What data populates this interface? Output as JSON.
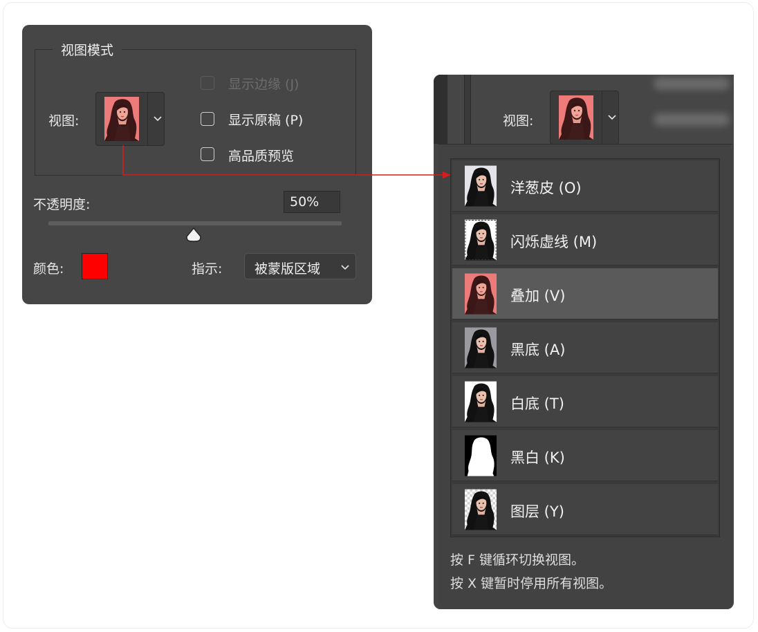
{
  "colors": {
    "panel_bg": "#464646",
    "accent_red": "#ff0000",
    "arrow_red": "#d91c1c",
    "menu_selected": "#5a5a5a"
  },
  "view_mode_panel": {
    "group_title": "视图模式",
    "view_label": "视图:",
    "checkboxes": [
      {
        "label": "显示边缘 (J)",
        "checked": false,
        "disabled": true
      },
      {
        "label": "显示原稿 (P)",
        "checked": false,
        "disabled": false
      },
      {
        "label": "高品质预览",
        "checked": false,
        "disabled": false
      }
    ],
    "opacity_label": "不透明度:",
    "opacity_value": "50%",
    "opacity_slider_fraction": 0.5,
    "color_label": "颜色:",
    "indicate_label": "指示:",
    "indicate_value": "被蒙版区域"
  },
  "view_menu": {
    "view_label": "视图:",
    "items": [
      {
        "label": "洋葱皮 (O)",
        "icon": "portrait-onion-skin-thumbnail"
      },
      {
        "label": "闪烁虚线 (M)",
        "icon": "portrait-marching-ants-thumbnail"
      },
      {
        "label": "叠加 (V)",
        "icon": "portrait-overlay-thumbnail",
        "selected": true
      },
      {
        "label": "黑底 (A)",
        "icon": "portrait-on-black-thumbnail"
      },
      {
        "label": "白底 (T)",
        "icon": "portrait-on-white-thumbnail"
      },
      {
        "label": "黑白 (K)",
        "icon": "black-white-mask-thumbnail"
      },
      {
        "label": "图层 (Y)",
        "icon": "portrait-on-layers-thumbnail"
      }
    ],
    "hint_cycle": "按 F 键循环切换视图。",
    "hint_disable": "按 X 键暂时停用所有视图。"
  }
}
